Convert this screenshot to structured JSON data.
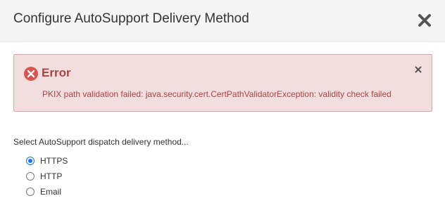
{
  "dialog": {
    "title": "Configure AutoSupport Delivery Method",
    "close_icon": "close-x-icon"
  },
  "alert": {
    "heading": "Error",
    "message": "PKIX path validation failed: java.security.cert.CertPathValidatorException: validity check failed",
    "icon": "error-circle-icon",
    "dismiss_icon": "close-icon",
    "colors": {
      "background": "#f2dede",
      "border": "#e3a3a6",
      "text": "#a94442",
      "icon": "#d9534f"
    }
  },
  "delivery": {
    "prompt": "Select AutoSupport dispatch delivery method...",
    "selected": "HTTPS",
    "options": [
      {
        "label": "HTTPS",
        "checked": true
      },
      {
        "label": "HTTP",
        "checked": false
      },
      {
        "label": "Email",
        "checked": false
      }
    ]
  }
}
